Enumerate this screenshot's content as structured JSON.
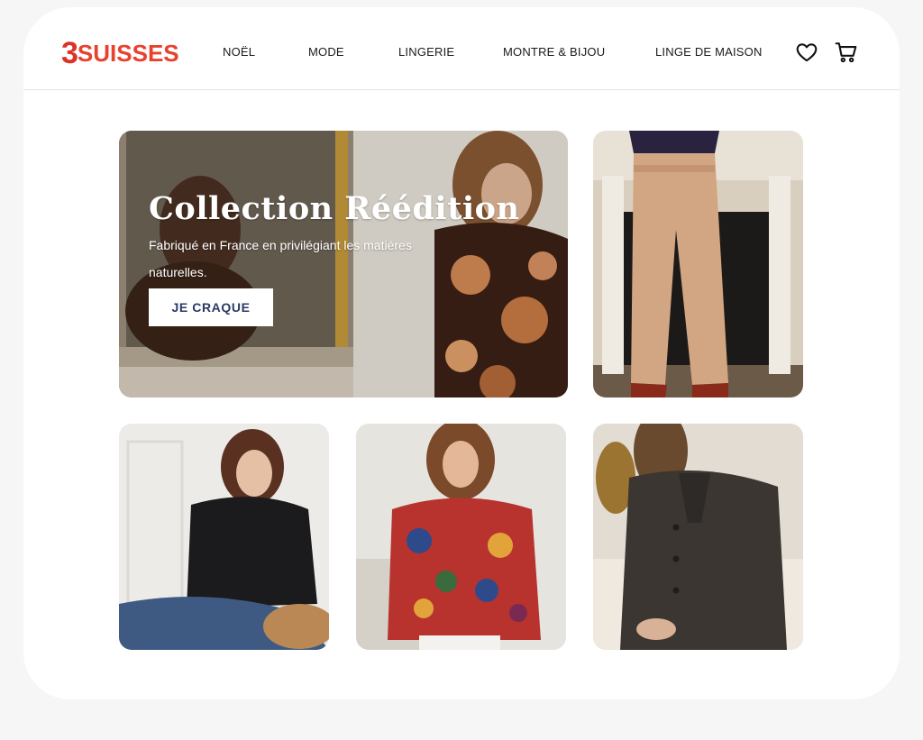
{
  "brand": {
    "logo_number": "3",
    "logo_text": "SUISSES",
    "color": "#e8412c"
  },
  "nav": {
    "items": [
      {
        "label": "NOËL"
      },
      {
        "label": "MODE"
      },
      {
        "label": "LINGERIE"
      },
      {
        "label": "MONTRE & BIJOU"
      },
      {
        "label": "LINGE DE MAISON"
      }
    ],
    "icons": [
      "heart-icon",
      "cart-icon"
    ]
  },
  "hero": {
    "title": "Collection Réédition",
    "subtitle": "Fabriqué en France en privilégiant les matières naturelles.",
    "button_label": "JE CRAQUE"
  },
  "products": [
    {
      "name": "beige-wide-trousers"
    },
    {
      "name": "black-satin-blouse"
    },
    {
      "name": "printed-silk-shirt"
    },
    {
      "name": "grey-wool-coat"
    }
  ]
}
